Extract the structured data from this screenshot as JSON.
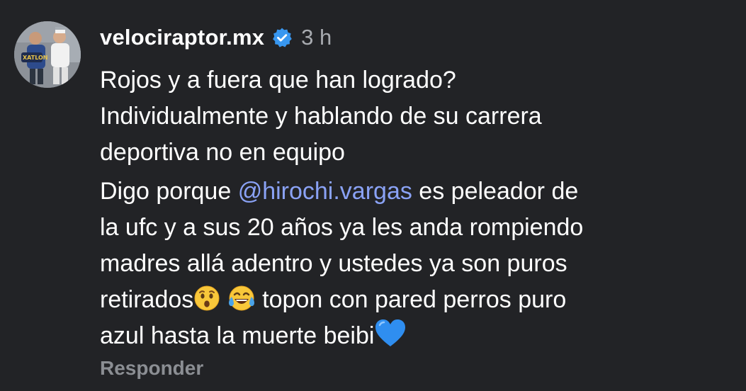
{
  "comment": {
    "username": "velociraptor.mx",
    "verified_icon": "verified-badge-icon",
    "time": "3 h",
    "paragraph1": {
      "lines": [
        "Rojos y a fuera que han logrado?",
        "Individualmente y hablando de su carrera",
        "deportiva no en equipo"
      ]
    },
    "paragraph2": {
      "line1_prefix": "Digo porque ",
      "mention": "@hirochi.vargas",
      "line1_suffix": " es peleador de",
      "line2": "la ufc y a sus 20 años ya les anda rompiendo",
      "line3": "madres allá adentro y ustedes ya son puros",
      "line4_prefix": "retirados",
      "line4_suffix": " topon con pared perros puro",
      "line5": "azul hasta la muerte beibi"
    },
    "emojis": [
      "hushed-face-icon",
      "tears-of-joy-icon",
      "blue-heart-icon"
    ],
    "reply_label": "Responder"
  },
  "colors": {
    "background": "#222326",
    "text": "#ffffff",
    "mention": "#8aa2f5",
    "secondary_text": "#a8abb0",
    "verified_badge": "#3897f0"
  }
}
